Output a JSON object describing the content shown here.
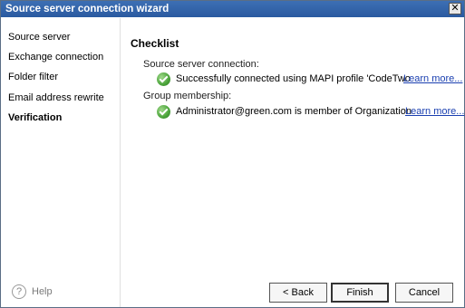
{
  "window": {
    "title": "Source server connection wizard",
    "close_glyph": "✕"
  },
  "sidebar": {
    "items": [
      {
        "label": "Source server"
      },
      {
        "label": "Exchange connection"
      },
      {
        "label": "Folder filter"
      },
      {
        "label": "Email address rewrite"
      },
      {
        "label": "Verification"
      }
    ],
    "help_label": "Help",
    "help_glyph": "?"
  },
  "main": {
    "title": "Checklist",
    "sections": [
      {
        "heading": "Source server connection:",
        "item_text": "Successfully connected using MAPI profile 'CodeTwo",
        "link": "Learn more..."
      },
      {
        "heading": "Group membership:",
        "item_text": "Administrator@green.com is member of Organization",
        "link": "Learn more..."
      }
    ]
  },
  "footer": {
    "back_label": "< Back",
    "finish_label": "Finish",
    "cancel_label": "Cancel"
  }
}
